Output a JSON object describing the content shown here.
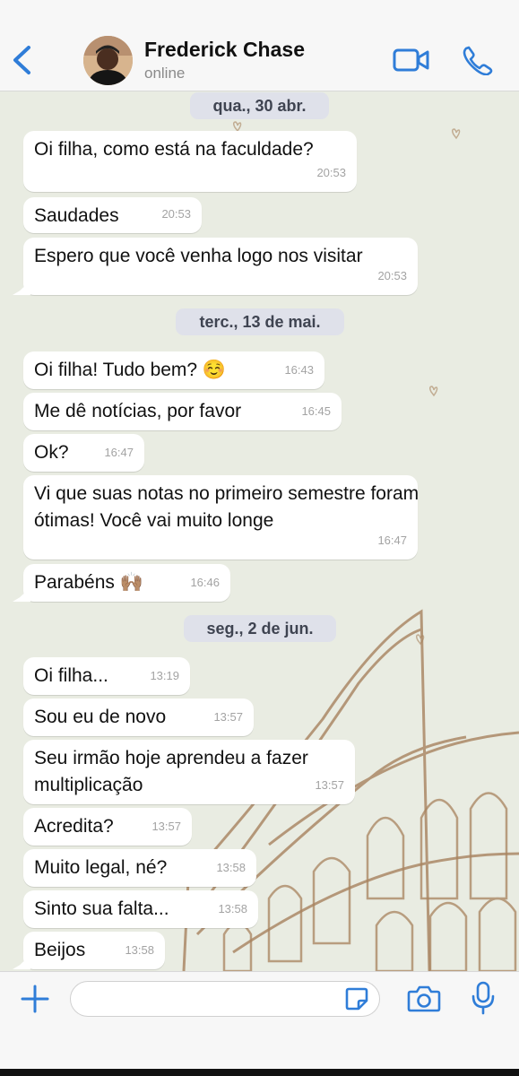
{
  "header": {
    "contact_name": "Frederick Chase",
    "status": "online",
    "icons": {
      "back": "chevron-left-icon",
      "video": "video-camera-icon",
      "call": "phone-icon"
    }
  },
  "dates": [
    "qua., 30 abr.",
    "terc., 13 de mai.",
    "seg., 2 de jun."
  ],
  "messages": [
    {
      "text": "Oi filha, como está na faculdade?",
      "time": "20:53"
    },
    {
      "text": "Saudades",
      "time": "20:53"
    },
    {
      "text": "Espero que você venha logo nos visitar",
      "time": "20:53"
    },
    {
      "text": "Oi filha! Tudo bem? ☺️",
      "time": "16:43"
    },
    {
      "text": "Me dê notícias, por favor",
      "time": "16:45"
    },
    {
      "text": "Ok?",
      "time": "16:47"
    },
    {
      "text": "Vi que suas notas no primeiro semestre foram ótimas! Você vai muito longe",
      "time": "16:47"
    },
    {
      "text": "Parabéns 🙌🏽",
      "time": "16:46"
    },
    {
      "text": "Oi filha...",
      "time": "13:19"
    },
    {
      "text": "Sou eu de novo",
      "time": "13:57"
    },
    {
      "text": "Seu irmão hoje aprendeu a fazer multiplicação",
      "time": "13:57"
    },
    {
      "text": "Acredita?",
      "time": "13:57"
    },
    {
      "text": "Muito legal, né?",
      "time": "13:58"
    },
    {
      "text": "Sinto sua falta...",
      "time": "13:58"
    },
    {
      "text": "Beijos",
      "time": "13:58"
    }
  ],
  "input": {
    "placeholder": "",
    "icons": {
      "attach": "plus-icon",
      "sticker": "sticker-icon",
      "camera": "camera-icon",
      "mic": "microphone-icon"
    }
  },
  "colors": {
    "accent": "#2f7dd8",
    "bubble": "#ffffff",
    "chat_background": "#e9ece2",
    "date_pill": "#dfe1ea"
  }
}
